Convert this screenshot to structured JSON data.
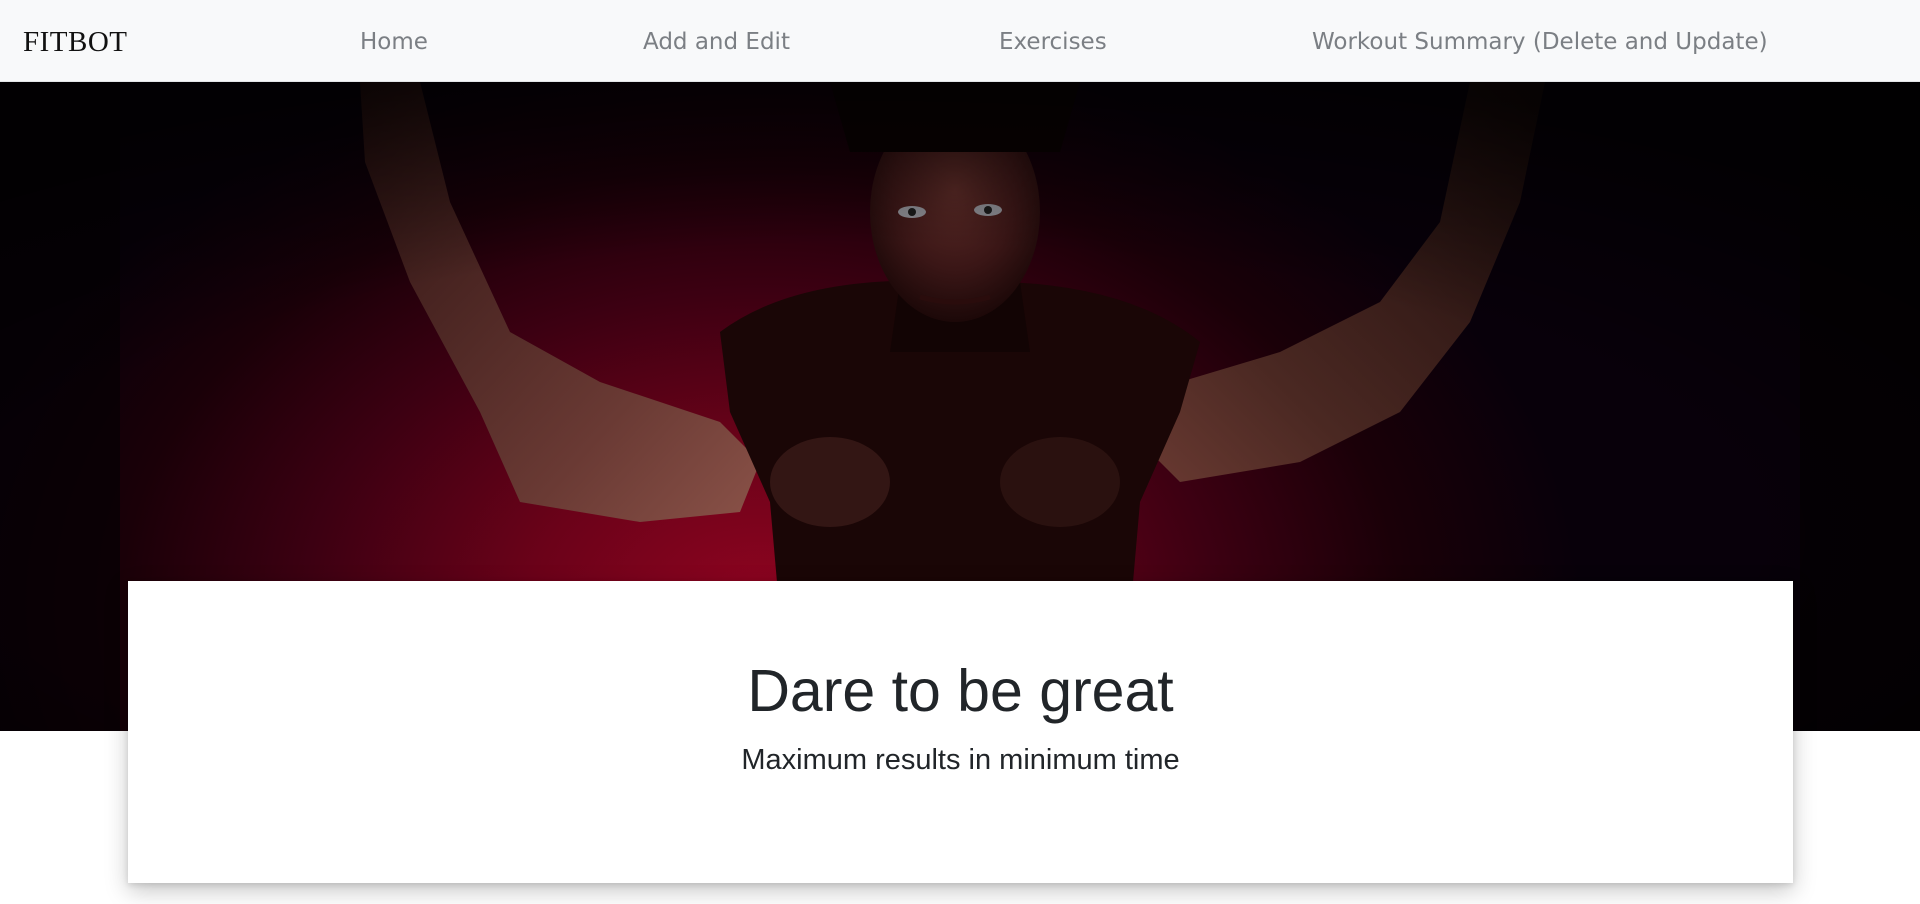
{
  "navbar": {
    "brand": "FITBOT",
    "links": [
      {
        "label": "Home"
      },
      {
        "label": "Add and Edit"
      },
      {
        "label": "Exercises"
      },
      {
        "label": "Workout Summary (Delete and Update)"
      }
    ]
  },
  "hero": {
    "title": "Dare to be great",
    "subtitle": "Maximum results in minimum time"
  },
  "colors": {
    "navbar_bg": "#f8f9fa",
    "nav_link": "#7b7f84",
    "hero_red": "#8e0420",
    "text_dark": "#212529"
  }
}
